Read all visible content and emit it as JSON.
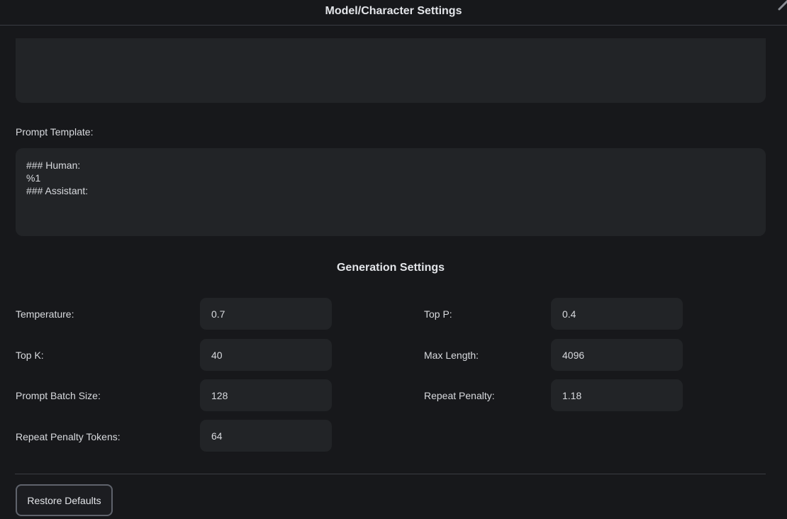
{
  "dialog": {
    "title": "Model/Character Settings"
  },
  "system_prompt": {
    "value": ""
  },
  "prompt_template": {
    "label": "Prompt Template:",
    "lines": [
      "### Human:",
      "%1",
      "### Assistant:"
    ]
  },
  "generation": {
    "title": "Generation Settings",
    "temperature": {
      "label": "Temperature:",
      "value": "0.7"
    },
    "top_p": {
      "label": "Top P:",
      "value": "0.4"
    },
    "top_k": {
      "label": "Top K:",
      "value": "40"
    },
    "max_length": {
      "label": "Max Length:",
      "value": "4096"
    },
    "prompt_batch_size": {
      "label": "Prompt Batch Size:",
      "value": "128"
    },
    "repeat_penalty": {
      "label": "Repeat Penalty:",
      "value": "1.18"
    },
    "repeat_penalty_tokens": {
      "label": "Repeat Penalty Tokens:",
      "value": "64"
    }
  },
  "footer": {
    "restore_label": "Restore Defaults"
  },
  "icons": {
    "close": "close-icon"
  },
  "colors": {
    "background": "#17181b",
    "field": "#222427",
    "text": "#d8dade",
    "divider": "#3a3c42",
    "button_border": "#5f636c"
  }
}
